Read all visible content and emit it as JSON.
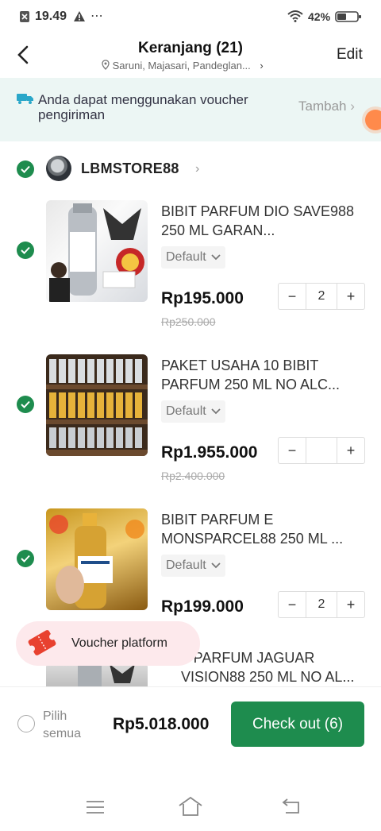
{
  "status_bar": {
    "time": "19.49",
    "battery": "42%"
  },
  "header": {
    "title": "Keranjang (21)",
    "location": "Saruni, Majasari, Pandeglan...",
    "edit_label": "Edit"
  },
  "banner": {
    "text": "Anda dapat menggunakan voucher pengiriman",
    "action": "Tambah"
  },
  "store": {
    "name": "LBMSTORE88"
  },
  "products": [
    {
      "name": "BIBIT PARFUM DIO SAVE988 250 ML GARAN...",
      "variant": "Default",
      "price": "Rp195.000",
      "old_price": "Rp250.000",
      "qty": "2"
    },
    {
      "name": "PAKET USAHA 10 BIBIT PARFUM 250 ML NO ALC...",
      "variant": "Default",
      "price": "Rp1.955.000",
      "old_price": "Rp2.400.000",
      "qty": ""
    },
    {
      "name": "BIBIT PARFUM E MONSPARCEL88 250 ML ...",
      "variant": "Default",
      "price": "Rp199.000",
      "old_price": "",
      "qty": "2"
    },
    {
      "name": "T PARFUM JAGUAR VISION88 250 ML  NO AL..."
    }
  ],
  "voucher_toast": {
    "label": "Voucher platform"
  },
  "footer": {
    "select_all": "Pilih semua",
    "total": "Rp5.018.000",
    "checkout": "Check out (6)"
  },
  "colors": {
    "accent": "#1e8c4e",
    "banner_bg": "#ecf6f4",
    "price": "#111111"
  },
  "icons": [
    "back-icon",
    "location-pin-icon",
    "truck-icon",
    "check-icon",
    "chevron-right-icon",
    "chevron-down-icon",
    "minus-icon",
    "plus-icon",
    "ticket-icon",
    "menu-icon",
    "home-icon",
    "back-nav-icon"
  ]
}
